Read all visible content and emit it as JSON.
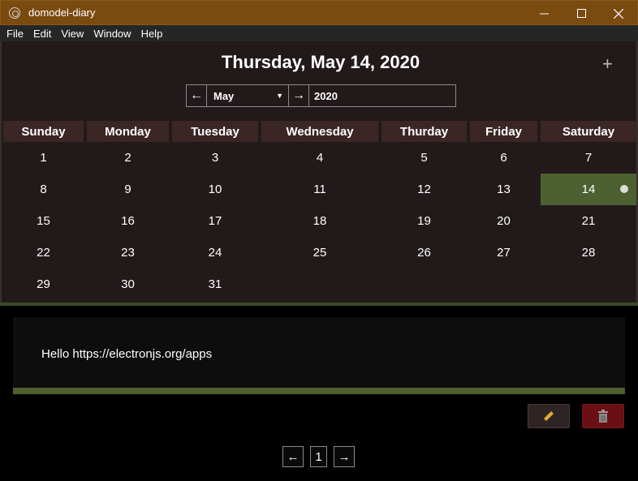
{
  "window": {
    "title": "domodel-diary",
    "minimize_glyph": "—",
    "maximize_glyph": "☐",
    "close_glyph": "✕",
    "icon": "app-icon"
  },
  "menu": [
    "File",
    "Edit",
    "View",
    "Window",
    "Help"
  ],
  "header": {
    "date_title": "Thursday, May 14, 2020",
    "add_label": "+"
  },
  "navigation": {
    "prev_label": "←",
    "next_label": "→",
    "month": "May",
    "year": "2020",
    "caret": "▼"
  },
  "calendar": {
    "day_names": [
      "Sunday",
      "Monday",
      "Tuesday",
      "Wednesday",
      "Thurday",
      "Friday",
      "Saturday"
    ],
    "weeks": [
      [
        "1",
        "2",
        "3",
        "4",
        "5",
        "6",
        "7"
      ],
      [
        "8",
        "9",
        "10",
        "11",
        "12",
        "13",
        "14"
      ],
      [
        "15",
        "16",
        "17",
        "18",
        "19",
        "20",
        "21"
      ],
      [
        "22",
        "23",
        "24",
        "25",
        "26",
        "27",
        "28"
      ],
      [
        "29",
        "30",
        "31",
        "",
        "",
        "",
        ""
      ]
    ],
    "selected_day": "14",
    "days_with_entries": [
      "14"
    ]
  },
  "entry": {
    "text": "Hello https://electronjs.org/apps"
  },
  "actions": {
    "edit_icon": "pencil-icon",
    "delete_icon": "trash-icon"
  },
  "pagination": {
    "prev_label": "←",
    "current_page": "1",
    "next_label": "→"
  },
  "colors": {
    "titlebar": "#7a4a0f",
    "selected_day": "#4c6031",
    "header_cell": "#3c2525",
    "delete_button": "#6a0f14"
  }
}
